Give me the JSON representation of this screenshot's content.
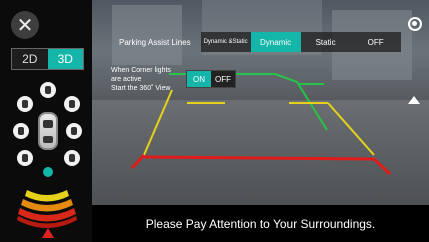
{
  "left_panel": {
    "close_icon": "close-icon",
    "view_modes": [
      {
        "label": "2D",
        "active": false
      },
      {
        "label": "3D",
        "active": true
      }
    ],
    "warning_icon": "warning-icon"
  },
  "top": {
    "settings_icon": "gear-icon"
  },
  "parking_assist": {
    "label": "Parking Assist Lines",
    "options": [
      {
        "label": "Dynamic &Static",
        "selected": false
      },
      {
        "label": "Dynamic",
        "selected": true
      },
      {
        "label": "Static",
        "selected": false
      },
      {
        "label": "OFF",
        "selected": false
      }
    ]
  },
  "corner_lights": {
    "text_line1": "When Corner lights",
    "text_line2": "are active",
    "text_line3": "Start the 360˚ View",
    "on_label": "ON",
    "off_label": "OFF",
    "value": "ON"
  },
  "status": {
    "notice": "Please Pay Attention to Your Surroundings."
  },
  "colors": {
    "accent": "#13b6a8",
    "guide_red": "#e01b1b",
    "guide_yellow": "#e6d21a",
    "guide_green": "#28c24a"
  }
}
